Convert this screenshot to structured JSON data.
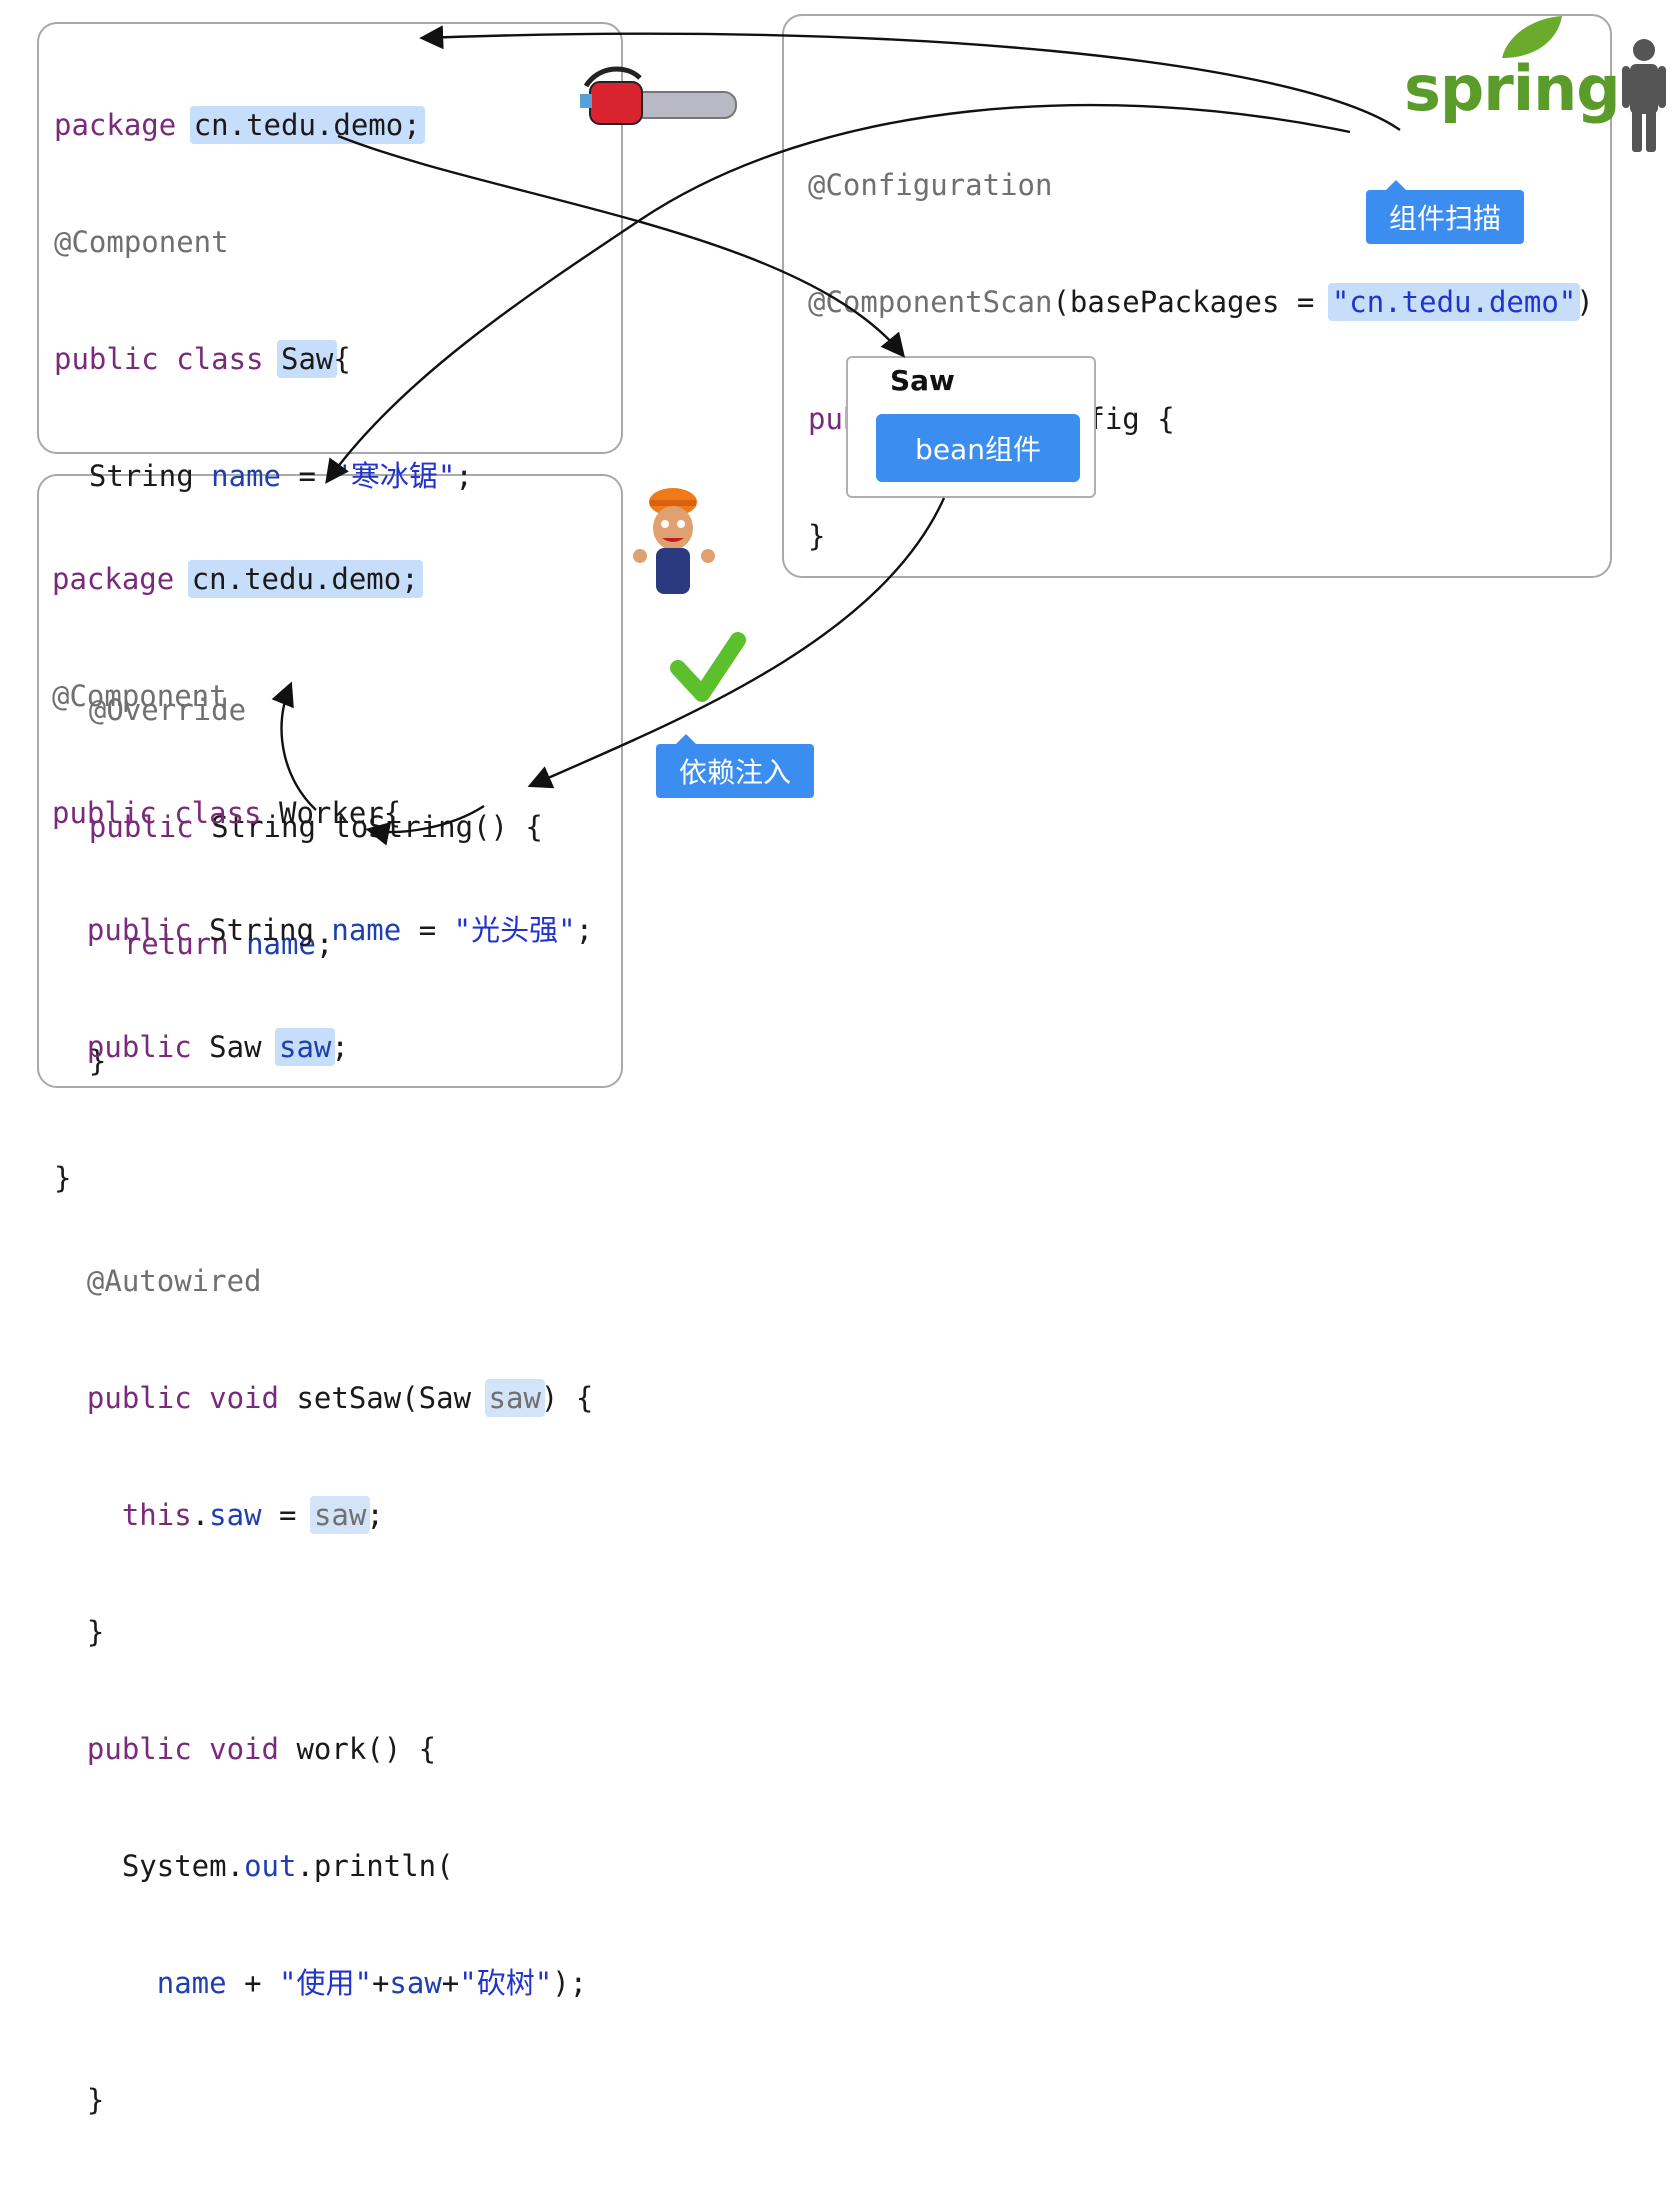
{
  "saw_code": {
    "line1_kw": "package",
    "line1_pkg": "cn.tedu.demo;",
    "line2": "@Component",
    "line3_kw": "public class",
    "line3_name": "Saw",
    "line3_brace": "{",
    "line4_type": "String",
    "line4_field": "name",
    "line4_eq": "=",
    "line4_str": "\"寒冰锯\"",
    "line4_semi": ";",
    "line6": "@Override",
    "line7_kw": "public",
    "line7_rest": "String toString() {",
    "line8_kw": "return",
    "line8_field": "name",
    "line8_semi": ";",
    "line9": "}",
    "line10": "}"
  },
  "worker_code": {
    "line1_kw": "package",
    "line1_pkg": "cn.tedu.demo;",
    "line2": "@Component",
    "line3_kw": "public class",
    "line3_rest": "Worker{",
    "line4_kw": "public",
    "line4_type": "String",
    "line4_field": "name",
    "line4_eq": "=",
    "line4_str": "\"光头强\"",
    "line4_semi": ";",
    "line5_kw": "public",
    "line5_type": "Saw",
    "line5_field": "saw",
    "line5_semi": ";",
    "line7": "@Autowired",
    "line8_kw": "public void",
    "line8_rest": "setSaw(Saw",
    "line8_param": "saw",
    "line8_end": ") {",
    "line9_kw": "this",
    "line9_dot": ".",
    "line9_field": "saw",
    "line9_eq": "=",
    "line9_param": "saw",
    "line9_semi": ";",
    "line10": "}",
    "line11_kw": "public void",
    "line11_rest": "work() {",
    "line12_a": "System.",
    "line12_out": "out",
    "line12_b": ".println(",
    "line13_field": "name",
    "line13_plus1": "+",
    "line13_str1": "\"使用\"",
    "line13_plus2": "+",
    "line13_saw": "saw",
    "line13_plus3": "+",
    "line13_str2": "\"砍树\"",
    "line13_end": ");",
    "line14": "}",
    "line15": "}"
  },
  "config_code": {
    "line1": "@Configuration",
    "line2_ann": "@ComponentScan",
    "line2_a": "(basePackages =",
    "line2_pkg": "\"cn.tedu.demo\"",
    "line2_end": ")",
    "line3_kw": "public class",
    "line3_rest": "Config {",
    "line4": "}"
  },
  "spring": {
    "logo_text": "spring",
    "logo_color": "#5b9b2a",
    "leaf_color": "#6aab2e"
  },
  "bean": {
    "title": "Saw",
    "button": "bean组件"
  },
  "tags": {
    "scan": "组件扫描",
    "inject": "依赖注入"
  },
  "colors": {
    "accent": "#3b8ef0",
    "check": "#5cc02c",
    "highlight": "#c7defa"
  }
}
